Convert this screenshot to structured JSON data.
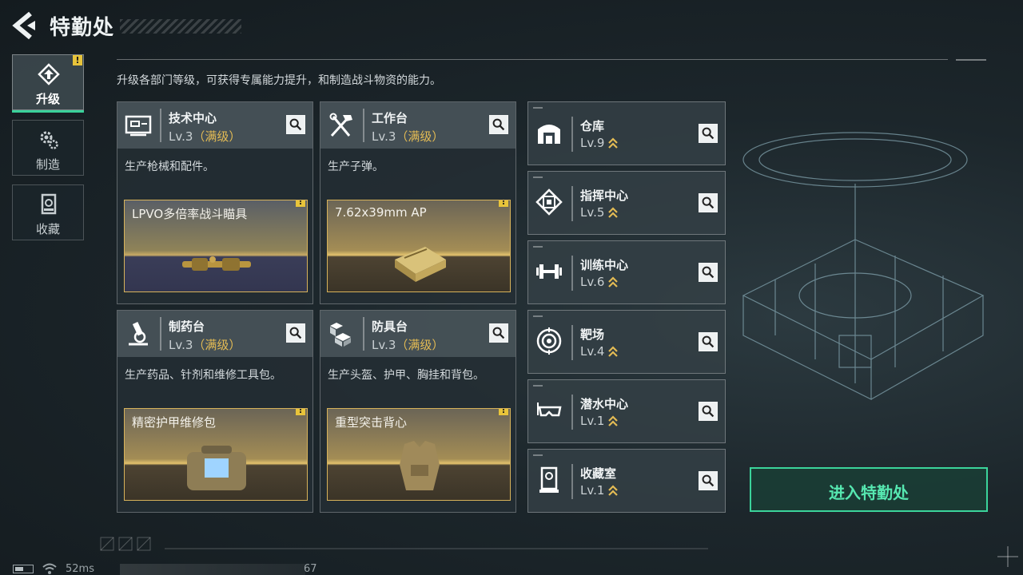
{
  "header": {
    "title": "特勤处",
    "back_icon": "back-arrow-icon"
  },
  "description": "升级各部门等级，可获得专属能力提升，和制造战斗物资的能力。",
  "nav": [
    {
      "label": "升级",
      "icon": "upgrade-icon",
      "active": true,
      "badge": "!"
    },
    {
      "label": "制造",
      "icon": "gear-icon",
      "active": false
    },
    {
      "label": "收藏",
      "icon": "collection-icon",
      "active": false
    }
  ],
  "departments": [
    {
      "name": "技术中心",
      "level": "Lv.3",
      "max_label": "（满级）",
      "desc": "生产枪械和配件。",
      "product": "LPVO多倍率战斗瞄具",
      "badge": "!",
      "icon": "tech-center-icon"
    },
    {
      "name": "工作台",
      "level": "Lv.3",
      "max_label": "（满级）",
      "desc": "生产子弹。",
      "product": "7.62x39mm AP",
      "badge": "!",
      "icon": "workbench-tools-icon"
    },
    {
      "name": "制药台",
      "level": "Lv.3",
      "max_label": "（满级）",
      "desc": "生产药品、针剂和维修工具包。",
      "product": "精密护甲维修包",
      "badge": "!",
      "icon": "microscope-icon"
    },
    {
      "name": "防具台",
      "level": "Lv.3",
      "max_label": "（满级）",
      "desc": "生产头盔、护甲、胸挂和背包。",
      "product": "重型突击背心",
      "badge": "!",
      "icon": "armor-blocks-icon"
    }
  ],
  "facilities": [
    {
      "name": "仓库",
      "level": "Lv.9",
      "icon": "warehouse-icon"
    },
    {
      "name": "指挥中心",
      "level": "Lv.5",
      "icon": "command-chip-icon"
    },
    {
      "name": "训练中心",
      "level": "Lv.6",
      "icon": "dumbbell-icon"
    },
    {
      "name": "靶场",
      "level": "Lv.4",
      "icon": "target-icon"
    },
    {
      "name": "潜水中心",
      "level": "Lv.1",
      "icon": "dive-mask-icon"
    },
    {
      "name": "收藏室",
      "level": "Lv.1",
      "icon": "collection-room-icon"
    }
  ],
  "enter_button": "进入特勤处",
  "status": {
    "ping": "52ms",
    "fps": "67"
  },
  "colors": {
    "accent_green": "#3bd49b",
    "maxed_gold": "#e3bb54",
    "warning": "#e8c43a"
  }
}
